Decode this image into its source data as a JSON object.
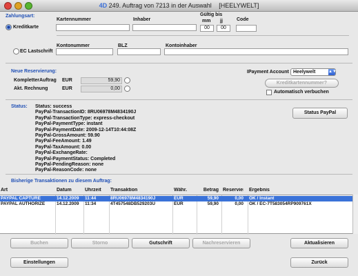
{
  "window": {
    "title": "249. Auftrag von 7213 in der Auswahl",
    "tag": "[HEELYWELT]",
    "app_icon": "4D"
  },
  "payment": {
    "section_label": "Zahlungsart:",
    "kreditkarte": {
      "label": "Kreditkarte",
      "selected": true,
      "col_kartennummer": "Kartennummer",
      "col_inhaber": "Inhaber",
      "col_gueltig": "Gültig bis",
      "col_mm": "mm",
      "col_jj": "jj",
      "col_code": "Code",
      "kartennummer": "",
      "inhaber": "",
      "mm": "00",
      "jj": "00",
      "code": ""
    },
    "lastschrift": {
      "label": "EC Lastschrift",
      "selected": false,
      "col_kontonummer": "Kontonummer",
      "col_blz": "BLZ",
      "col_kontoinhaber": "Kontoinhaber",
      "kontonummer": "",
      "blz": "",
      "kontoinhaber": ""
    }
  },
  "reservation": {
    "section_label": "Neue Reservierung:",
    "komplett_label": "KompletterAuftrag",
    "komplett_currency": "EUR",
    "komplett_value": "59,90",
    "akt_label": "Akt. Rechnung",
    "akt_currency": "EUR",
    "akt_value": "0,00",
    "ipayment_label": "IPayment Account",
    "ipayment_value": "Heelywelt",
    "kreditkarten_button": "Kreditkartennummer?",
    "auto_label": "Automatisch verbuchen",
    "auto_checked": false
  },
  "status": {
    "section_label": "Status:",
    "lines": [
      "Status: success",
      "PayPal-TransactionID: 8RU06978M4834190J",
      "PayPal-TransactionType: express-checkout",
      "PayPal-PaymentType: instant",
      "PayPal-PaymentDate: 2009-12-14T10:44:08Z",
      "PayPal-GrossAmount: 59.90",
      "PayPal-FeeAmount: 1.49",
      "PayPal-TaxAmount: 0.00",
      "PayPal-ExchangeRate:",
      "PayPal-PaymentStatus: Completed",
      "PayPal-PendingReason: none",
      "PayPal-ReasonCode: none"
    ],
    "paypal_button": "Status PayPal"
  },
  "transactions": {
    "section_label": "Bisherige Transaktionen zu diesem Auftrag:",
    "headers": [
      "Art",
      "Datum",
      "Uhrzeit",
      "Transaktion",
      "Währ.",
      "Betrag",
      "Reserviert",
      "Ergebnis"
    ],
    "rows": [
      [
        "PAYPAL CAPTURE",
        "14.12.2009",
        "11:44",
        "8RU06978M4834190J",
        "EUR",
        "59,90",
        "0,00",
        "OK / Instant"
      ],
      [
        "PAYPAL AUTHORIZE",
        "14.12.2009",
        "11:34",
        "4T457548DB529203U",
        "EUR",
        "59,90",
        "0,00",
        "OK / EC-7T583054RP909761X"
      ]
    ],
    "selected_row": 0
  },
  "buttons": {
    "buchen": "Buchen",
    "storno": "Storno",
    "gutschrift": "Gutschrift",
    "nachreservieren": "Nachreservieren",
    "aktualisieren": "Aktualisieren",
    "einstellungen": "Einstellungen",
    "zurueck": "Zurück"
  },
  "colors": {
    "accent": "#1f4fb5",
    "selection": "#3a72d8",
    "close": "#e0443e",
    "minimize": "#dea123",
    "zoom": "#58b52f"
  }
}
